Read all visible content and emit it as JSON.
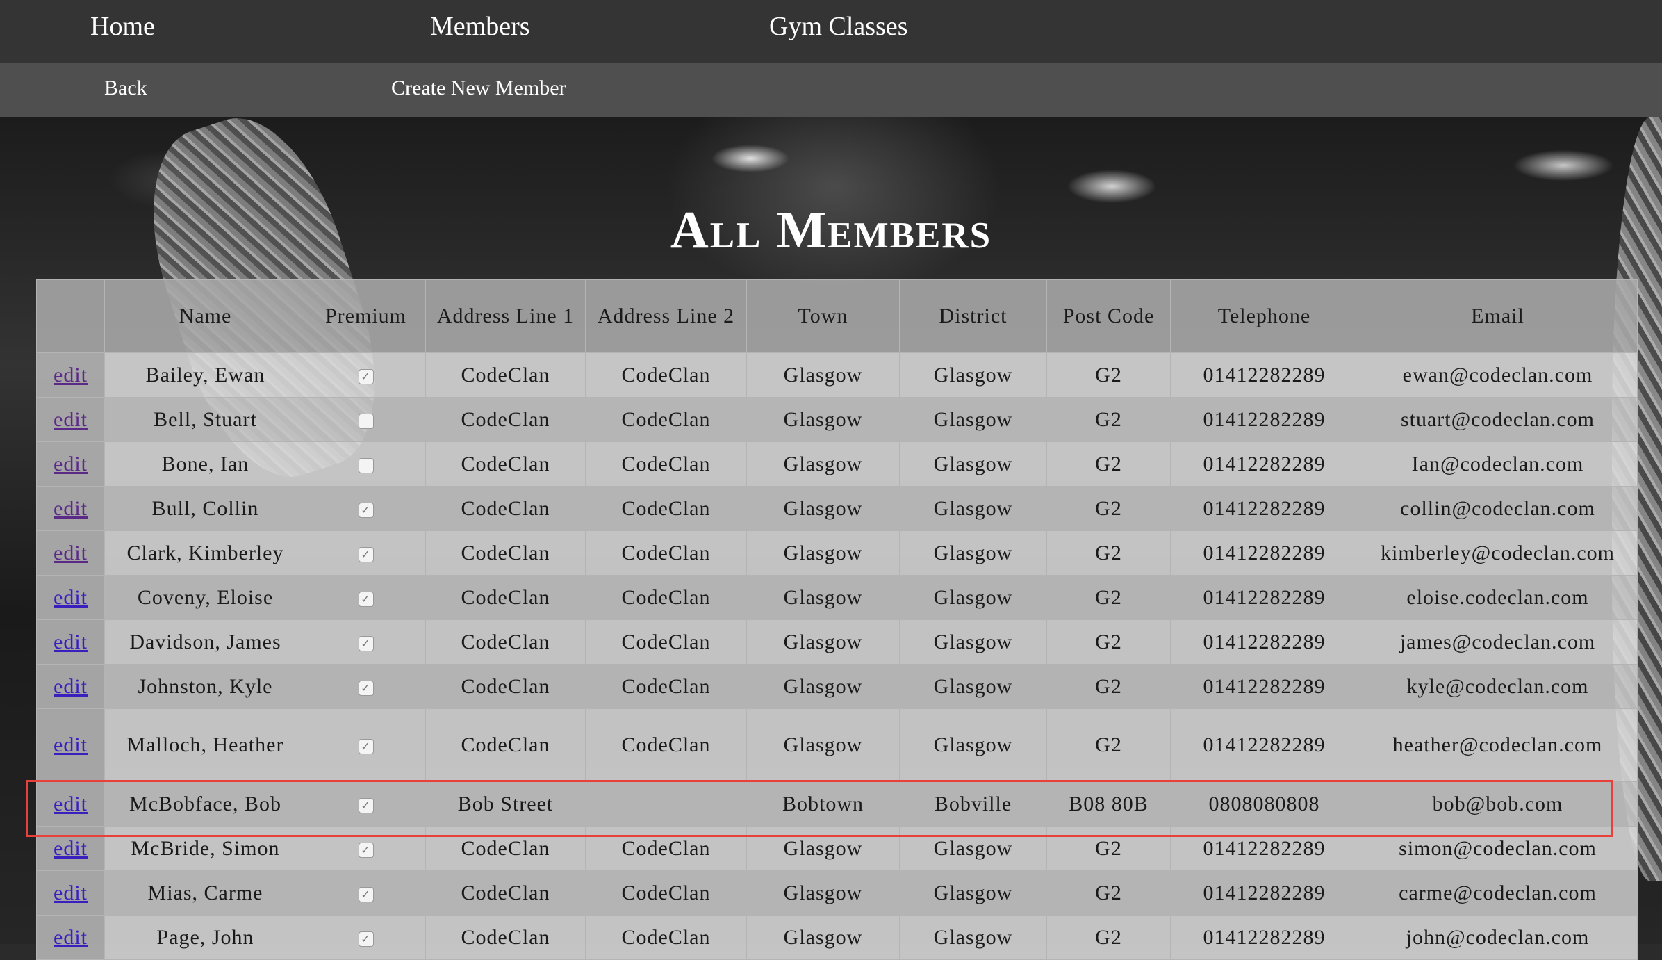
{
  "nav": {
    "home": "Home",
    "members": "Members",
    "gym_classes": "Gym Classes"
  },
  "subnav": {
    "back": "Back",
    "create_new_member": "Create New Member"
  },
  "page": {
    "title": "All Members"
  },
  "table": {
    "headers": [
      "",
      "Name",
      "Premium",
      "Address Line 1",
      "Address Line 2",
      "Town",
      "District",
      "Post Code",
      "Telephone",
      "Email"
    ],
    "edit_label": "edit",
    "rows": [
      {
        "name": "Bailey, Ewan",
        "premium": true,
        "address1": "CodeClan",
        "address2": "CodeClan",
        "town": "Glasgow",
        "district": "Glasgow",
        "postcode": "G2",
        "telephone": "01412282289",
        "email": "ewan@codeclan.com",
        "visited": true
      },
      {
        "name": "Bell, Stuart",
        "premium": false,
        "address1": "CodeClan",
        "address2": "CodeClan",
        "town": "Glasgow",
        "district": "Glasgow",
        "postcode": "G2",
        "telephone": "01412282289",
        "email": "stuart@codeclan.com",
        "visited": true
      },
      {
        "name": "Bone, Ian",
        "premium": false,
        "address1": "CodeClan",
        "address2": "CodeClan",
        "town": "Glasgow",
        "district": "Glasgow",
        "postcode": "G2",
        "telephone": "01412282289",
        "email": "Ian@codeclan.com",
        "visited": true
      },
      {
        "name": "Bull, Collin",
        "premium": true,
        "address1": "CodeClan",
        "address2": "CodeClan",
        "town": "Glasgow",
        "district": "Glasgow",
        "postcode": "G2",
        "telephone": "01412282289",
        "email": "collin@codeclan.com",
        "visited": true
      },
      {
        "name": "Clark, Kimberley",
        "premium": true,
        "address1": "CodeClan",
        "address2": "CodeClan",
        "town": "Glasgow",
        "district": "Glasgow",
        "postcode": "G2",
        "telephone": "01412282289",
        "email": "kimberley@codeclan.com",
        "visited": true
      },
      {
        "name": "Coveny, Eloise",
        "premium": true,
        "address1": "CodeClan",
        "address2": "CodeClan",
        "town": "Glasgow",
        "district": "Glasgow",
        "postcode": "G2",
        "telephone": "01412282289",
        "email": "eloise.codeclan.com",
        "visited": false
      },
      {
        "name": "Davidson, James",
        "premium": true,
        "address1": "CodeClan",
        "address2": "CodeClan",
        "town": "Glasgow",
        "district": "Glasgow",
        "postcode": "G2",
        "telephone": "01412282289",
        "email": "james@codeclan.com",
        "visited": false
      },
      {
        "name": "Johnston, Kyle",
        "premium": true,
        "address1": "CodeClan",
        "address2": "CodeClan",
        "town": "Glasgow",
        "district": "Glasgow",
        "postcode": "G2",
        "telephone": "01412282289",
        "email": "kyle@codeclan.com",
        "visited": false
      },
      {
        "name": "Malloch, Heather",
        "premium": true,
        "address1": "CodeClan",
        "address2": "CodeClan",
        "town": "Glasgow",
        "district": "Glasgow",
        "postcode": "G2",
        "telephone": "01412282289",
        "email": "heather@codeclan.com",
        "visited": false,
        "tall": true
      },
      {
        "name": "McBobface, Bob",
        "premium": true,
        "address1": "Bob Street",
        "address2": "",
        "town": "Bobtown",
        "district": "Bobville",
        "postcode": "B08 80B",
        "telephone": "0808080808",
        "email": "bob@bob.com",
        "visited": false
      },
      {
        "name": "McBride, Simon",
        "premium": true,
        "address1": "CodeClan",
        "address2": "CodeClan",
        "town": "Glasgow",
        "district": "Glasgow",
        "postcode": "G2",
        "telephone": "01412282289",
        "email": "simon@codeclan.com",
        "visited": false
      },
      {
        "name": "Mias, Carme",
        "premium": true,
        "address1": "CodeClan",
        "address2": "CodeClan",
        "town": "Glasgow",
        "district": "Glasgow",
        "postcode": "G2",
        "telephone": "01412282289",
        "email": "carme@codeclan.com",
        "visited": false
      },
      {
        "name": "Page, John",
        "premium": true,
        "address1": "CodeClan",
        "address2": "CodeClan",
        "town": "Glasgow",
        "district": "Glasgow",
        "postcode": "G2",
        "telephone": "01412282289",
        "email": "john@codeclan.com",
        "visited": false
      }
    ]
  },
  "colors": {
    "nav_bg": "#343434",
    "subnav_bg": "#4f4f4f",
    "link": "#3a1fbf",
    "link_visited": "#5b2a86",
    "highlight": "#e8403a"
  }
}
